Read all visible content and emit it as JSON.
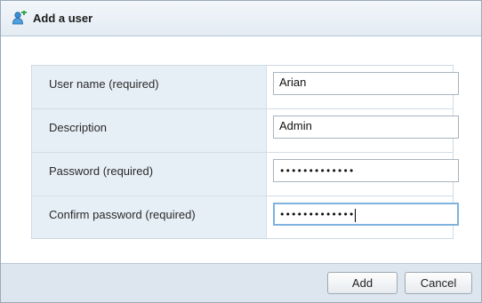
{
  "dialog": {
    "title": "Add a user",
    "title_icon": "add-user-icon"
  },
  "form": {
    "rows": [
      {
        "label": "User name (required)",
        "value": "Arian",
        "type": "text"
      },
      {
        "label": "Description",
        "value": "Admin",
        "type": "text"
      },
      {
        "label": "Password (required)",
        "value": "•••••••••••••",
        "type": "password"
      },
      {
        "label": "Confirm password (required)",
        "value": "•••••••••••••",
        "type": "password",
        "focused": true
      }
    ]
  },
  "footer": {
    "add_label": "Add",
    "cancel_label": "Cancel"
  },
  "colors": {
    "title_bar": "#e3ebf3",
    "label_column": "#e6eef6",
    "footer": "#dde6ef",
    "focus_border": "#7fb2de"
  }
}
